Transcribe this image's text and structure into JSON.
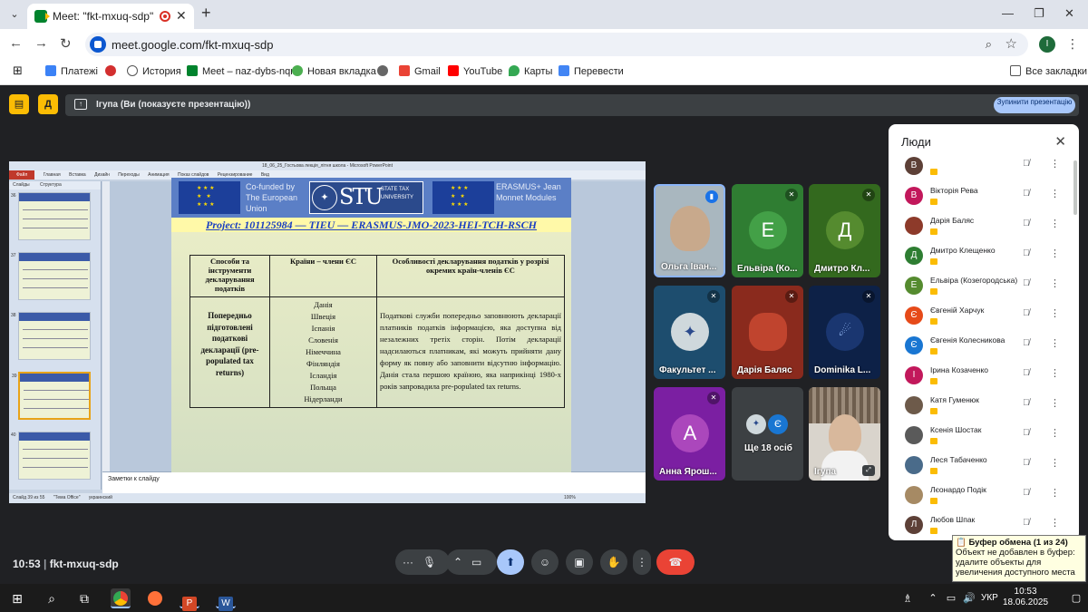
{
  "browser": {
    "tab_title": "Meet: \"fkt-mxuq-sdp\"",
    "url": "meet.google.com/fkt-mxuq-sdp",
    "profile_initial": "I",
    "bookmarks": [
      "Платежі",
      "История",
      "Meet – naz-dybs-nqr",
      "Новая вкладка",
      "Gmail",
      "YouTube",
      "Карты",
      "Перевести"
    ],
    "all_bookmarks": "Все закладки"
  },
  "meet": {
    "presenting_text": "Ігупа (Ви (показуєте презентацію))",
    "stop_button": "Зупинити презентацію",
    "time": "10:53",
    "meeting_code": "fkt-mxuq-sdp",
    "more_count": "Ще 18 осіб"
  },
  "ppt": {
    "title": "18_06_25_Гостьова лекція_літня школа - Microsoft PowerPoint",
    "file_tab": "Файл",
    "ribbon_tabs": [
      "Главная",
      "Вставка",
      "Дизайн",
      "Переходы",
      "Анимация",
      "Показ слайдов",
      "Рецензирование",
      "Вид"
    ],
    "thumb_tabs": [
      "Слайды",
      "Структура"
    ],
    "thumb_numbers": [
      "36",
      "37",
      "38",
      "39",
      "40"
    ],
    "notes_placeholder": "Заметки к слайду",
    "status_slide": "Слайд 39 из 55",
    "status_theme": "\"Тема Office\"",
    "status_lang": "украинский",
    "zoom": "100%"
  },
  "slide": {
    "cofunded": "Co-funded by The European Union",
    "stu_letters": "STU",
    "stu_sub": "STATE TAX UNIVERSITY",
    "erasmus": "ERASMUS+ Jean Monnet Modules",
    "project": "Project: 101125984 — TIEU — ERASMUS-JMO-2023-HEI-TCH-RSCH",
    "col1_header": "Способи та інструменти декларування податків",
    "col2_header": "Країни – члени ЄС",
    "col3_header": "Особливості декларування податків у розрізі окремих країн-членів ЄС",
    "row_method": "Попередньо підготовлені податкові декларації (pre-populated tax returns)",
    "countries": [
      "Данія",
      "Швеція",
      "Іспанія",
      "Словенія",
      "Німеччина",
      "Фінляндія",
      "Ісландія",
      "Польща",
      "Нідерланди"
    ],
    "features": "Податкові служби попередньо заповнюють декларації платників податків інформацією, яка доступна від незалежних третіх сторін. Потім декларації надсилаються платникам, які можуть прийняти дану форму як повну або заповнити відсутню інформацію. Данія стала першою країною, яка наприкінці 1980-х років запровадила pre-populated tax returns."
  },
  "tiles": [
    {
      "name": "Ольга Іван...",
      "initial": ""
    },
    {
      "name": "Ельвіра (Ко...",
      "initial": "Е"
    },
    {
      "name": "Дмитро Кл...",
      "initial": "Д"
    },
    {
      "name": "Факультет ...",
      "initial": ""
    },
    {
      "name": "Дарія Баляс",
      "initial": ""
    },
    {
      "name": "Dominika L...",
      "initial": ""
    },
    {
      "name": "Анна Ярош...",
      "initial": "А"
    },
    {
      "name": "Ігупа",
      "initial": ""
    }
  ],
  "more_avatar_initial": "Є",
  "people": {
    "title": "Люди",
    "list": [
      {
        "name": "",
        "initial": "В",
        "color": "#5d4037"
      },
      {
        "name": "Вікторія Рева",
        "initial": "В",
        "color": "#c2185b"
      },
      {
        "name": "Дарія Баляс",
        "initial": "",
        "color": "#8d3a2a"
      },
      {
        "name": "Дмитро Клещенко",
        "initial": "Д",
        "color": "#2e7d32"
      },
      {
        "name": "Ельвіра (Козегородська)",
        "initial": "Е",
        "color": "#558b2f"
      },
      {
        "name": "Євгеній Харчук",
        "initial": "Є",
        "color": "#e64a19"
      },
      {
        "name": "Євгенія Колесникова",
        "initial": "Є",
        "color": "#1976d2"
      },
      {
        "name": "Ірина Козаченко",
        "initial": "І",
        "color": "#c2185b"
      },
      {
        "name": "Катя Гуменюк",
        "initial": "",
        "color": "#6d5a4a"
      },
      {
        "name": "Ксенія Шостак",
        "initial": "",
        "color": "#5a5a5a"
      },
      {
        "name": "Леся Табаченко",
        "initial": "",
        "color": "#4a6b8a"
      },
      {
        "name": "Лєонардо Подік",
        "initial": "",
        "color": "#a68a64"
      },
      {
        "name": "Любов Шпак",
        "initial": "Л",
        "color": "#5d4037"
      }
    ]
  },
  "clipboard": {
    "title": "Буфер обмена (1 из 24)",
    "message": "Объект не добавлен в буфер: удалите объекты для увеличения доступного места"
  },
  "taskbar": {
    "lang": "УКР",
    "time": "10:53",
    "date": "18.06.2025"
  }
}
